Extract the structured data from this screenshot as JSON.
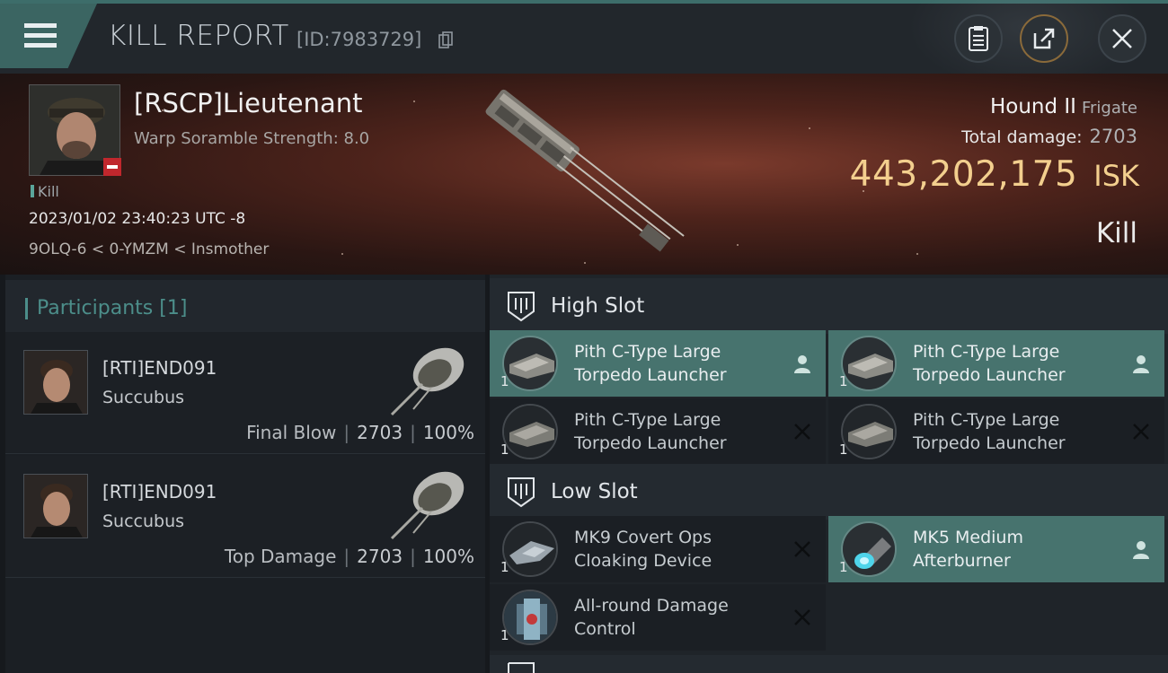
{
  "header": {
    "title": "KILL REPORT",
    "report_id": "[ID:7983729]"
  },
  "victim": {
    "name": "[RSCP]Lieutenant",
    "subtitle": "Warp Soramble Strength: 8.0",
    "tag": "Kill",
    "timestamp": "2023/01/02 23:40:23 UTC -8",
    "location": "9OLQ-6 < 0-YMZM < Insmother"
  },
  "ship": {
    "name": "Hound II",
    "class": "Frigate",
    "total_damage_label": "Total damage:",
    "total_damage": "2703",
    "isk_value": "443,202,175",
    "isk_unit": "ISK",
    "result": "Kill"
  },
  "participants": {
    "title": "Participants",
    "count": "[1]",
    "rows": [
      {
        "name": "[RTI]END091",
        "ship": "Succubus",
        "role": "Final Blow",
        "damage": "2703",
        "percent": "100%"
      },
      {
        "name": "[RTI]END091",
        "ship": "Succubus",
        "role": "Top Damage",
        "damage": "2703",
        "percent": "100%"
      }
    ]
  },
  "slots": {
    "high": {
      "title": "High Slot",
      "modules": [
        {
          "line1": "Pith C-Type Large",
          "line2": "Torpedo Launcher",
          "qty": "1",
          "state": "fitted"
        },
        {
          "line1": "Pith C-Type Large",
          "line2": "Torpedo Launcher",
          "qty": "1",
          "state": "fitted"
        },
        {
          "line1": "Pith C-Type Large",
          "line2": "Torpedo Launcher",
          "qty": "1",
          "state": "destroyed"
        },
        {
          "line1": "Pith C-Type Large",
          "line2": "Torpedo Launcher",
          "qty": "1",
          "state": "destroyed"
        }
      ]
    },
    "low": {
      "title": "Low Slot",
      "modules": [
        {
          "line1": "MK9 Covert Ops",
          "line2": "Cloaking Device",
          "qty": "1",
          "state": "destroyed"
        },
        {
          "line1": "MK5 Medium",
          "line2": "Afterburner",
          "qty": "1",
          "state": "fitted"
        },
        {
          "line1": "All-round Damage",
          "line2": "Control",
          "qty": "1",
          "state": "destroyed"
        }
      ]
    }
  },
  "colors": {
    "accent": "#47736e",
    "isk": "#f3cf8e",
    "destroyed_badge": "#c0272d"
  },
  "icons": {
    "menu": "hamburger-icon",
    "copy": "copy-icon",
    "clipboard": "clipboard-icon",
    "share": "share-icon",
    "close": "close-icon",
    "slot": "slot-icon",
    "fitted": "person-icon",
    "destroyed": "x-icon"
  }
}
